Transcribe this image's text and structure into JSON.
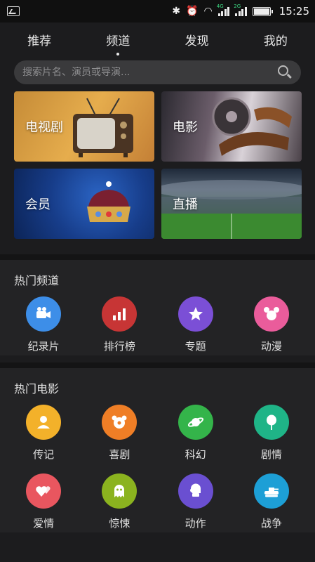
{
  "status_bar": {
    "time": "15:25",
    "network_4g": "4G",
    "network_2g": "2G"
  },
  "nav": {
    "tabs": [
      {
        "label": "推荐"
      },
      {
        "label": "频道",
        "active": true
      },
      {
        "label": "发现"
      },
      {
        "label": "我的"
      }
    ]
  },
  "search": {
    "placeholder": "搜索片名、演员或导演..."
  },
  "tiles": [
    {
      "label": "电视剧"
    },
    {
      "label": "电影"
    },
    {
      "label": "会员"
    },
    {
      "label": "直播"
    }
  ],
  "hot_channels": {
    "title": "热门频道",
    "items": [
      {
        "label": "纪录片",
        "icon": "video-camera-icon",
        "color": "#3d8ee8"
      },
      {
        "label": "排行榜",
        "icon": "bar-chart-icon",
        "color": "#c73535"
      },
      {
        "label": "专题",
        "icon": "star-icon",
        "color": "#7b4fd6"
      },
      {
        "label": "动漫",
        "icon": "mickey-icon",
        "color": "#ea5c9b"
      }
    ]
  },
  "hot_movies": {
    "title": "热门电影",
    "rows": [
      [
        {
          "label": "传记",
          "icon": "person-icon",
          "color": "#f3b12a"
        },
        {
          "label": "喜剧",
          "icon": "clown-icon",
          "color": "#ef7e26"
        },
        {
          "label": "科幻",
          "icon": "planet-icon",
          "color": "#34b44a"
        },
        {
          "label": "剧情",
          "icon": "balloon-icon",
          "color": "#1fb487"
        }
      ],
      [
        {
          "label": "爱情",
          "icon": "hearts-icon",
          "color": "#e9565f"
        },
        {
          "label": "惊悚",
          "icon": "ghost-icon",
          "color": "#8bb31f"
        },
        {
          "label": "动作",
          "icon": "boxing-glove-icon",
          "color": "#6a4fd1"
        },
        {
          "label": "战争",
          "icon": "tank-icon",
          "color": "#1d9fd6"
        }
      ]
    ]
  }
}
